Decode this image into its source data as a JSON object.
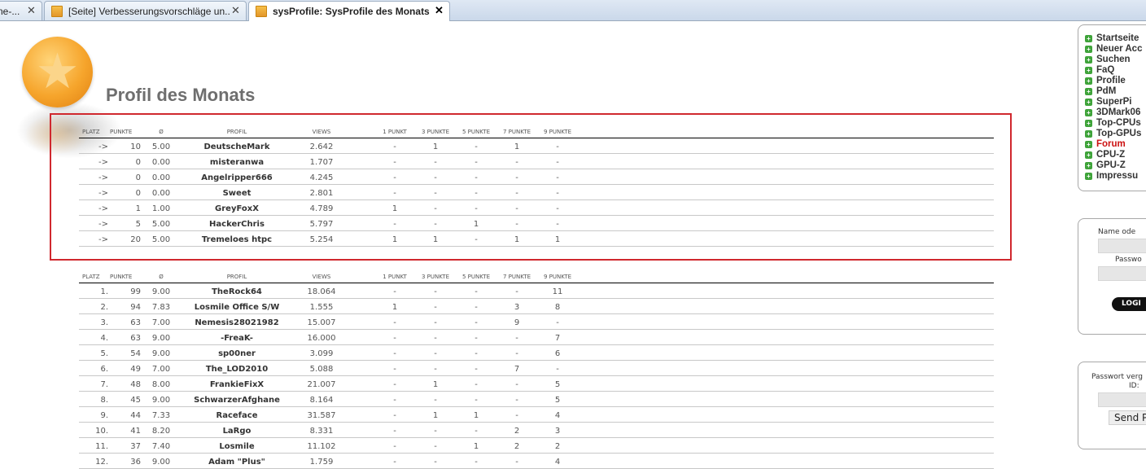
{
  "browser": {
    "tabs": [
      {
        "label": "ne-...",
        "active": false
      },
      {
        "label": "[Seite] Verbesserungsvorschläge un...",
        "active": false
      },
      {
        "label": "sysProfile: SysProfile des Monats",
        "active": true
      }
    ],
    "close_glyph": "✕"
  },
  "page": {
    "title": "Profil des Monats"
  },
  "table_headers": {
    "platz": "PLATZ",
    "punkte": "PUNKTE",
    "avg": "Ø",
    "profil": "PROFIL",
    "views": "VIEWS",
    "p1": "1 PUNKT",
    "p3": "3 PUNKTE",
    "p5": "5 PUNKTE",
    "p7": "7 PUNKTE",
    "p9": "9 PUNKTE"
  },
  "upcoming": {
    "rows": [
      {
        "platz": "->",
        "punkte": "10",
        "avg": "5.00",
        "profil": "DeutscheMark",
        "views": "2.642",
        "p1": "-",
        "p3": "1",
        "p5": "-",
        "p7": "1",
        "p9": "-"
      },
      {
        "platz": "->",
        "punkte": "0",
        "avg": "0.00",
        "profil": "misteranwa",
        "views": "1.707",
        "p1": "-",
        "p3": "-",
        "p5": "-",
        "p7": "-",
        "p9": "-"
      },
      {
        "platz": "->",
        "punkte": "0",
        "avg": "0.00",
        "profil": "Angelripper666",
        "views": "4.245",
        "p1": "-",
        "p3": "-",
        "p5": "-",
        "p7": "-",
        "p9": "-"
      },
      {
        "platz": "->",
        "punkte": "0",
        "avg": "0.00",
        "profil": "Sweet",
        "views": "2.801",
        "p1": "-",
        "p3": "-",
        "p5": "-",
        "p7": "-",
        "p9": "-"
      },
      {
        "platz": "->",
        "punkte": "1",
        "avg": "1.00",
        "profil": "GreyFoxX",
        "views": "4.789",
        "p1": "1",
        "p3": "-",
        "p5": "-",
        "p7": "-",
        "p9": "-"
      },
      {
        "platz": "->",
        "punkte": "5",
        "avg": "5.00",
        "profil": "HackerChris",
        "views": "5.797",
        "p1": "-",
        "p3": "-",
        "p5": "1",
        "p7": "-",
        "p9": "-"
      },
      {
        "platz": "->",
        "punkte": "20",
        "avg": "5.00",
        "profil": "Tremeloes htpc",
        "views": "5.254",
        "p1": "1",
        "p3": "1",
        "p5": "-",
        "p7": "1",
        "p9": "1"
      }
    ]
  },
  "ranking": {
    "rows": [
      {
        "platz": "1.",
        "punkte": "99",
        "avg": "9.00",
        "profil": "TheRock64",
        "views": "18.064",
        "p1": "-",
        "p3": "-",
        "p5": "-",
        "p7": "-",
        "p9": "11"
      },
      {
        "platz": "2.",
        "punkte": "94",
        "avg": "7.83",
        "profil": "Losmile Office S/W",
        "views": "1.555",
        "p1": "1",
        "p3": "-",
        "p5": "-",
        "p7": "3",
        "p9": "8"
      },
      {
        "platz": "3.",
        "punkte": "63",
        "avg": "7.00",
        "profil": "Nemesis28021982",
        "views": "15.007",
        "p1": "-",
        "p3": "-",
        "p5": "-",
        "p7": "9",
        "p9": "-"
      },
      {
        "platz": "4.",
        "punkte": "63",
        "avg": "9.00",
        "profil": "-FreaK-",
        "views": "16.000",
        "p1": "-",
        "p3": "-",
        "p5": "-",
        "p7": "-",
        "p9": "7"
      },
      {
        "platz": "5.",
        "punkte": "54",
        "avg": "9.00",
        "profil": "sp00ner",
        "views": "3.099",
        "p1": "-",
        "p3": "-",
        "p5": "-",
        "p7": "-",
        "p9": "6"
      },
      {
        "platz": "6.",
        "punkte": "49",
        "avg": "7.00",
        "profil": "The_LOD2010",
        "views": "5.088",
        "p1": "-",
        "p3": "-",
        "p5": "-",
        "p7": "7",
        "p9": "-"
      },
      {
        "platz": "7.",
        "punkte": "48",
        "avg": "8.00",
        "profil": "FrankieFixX",
        "views": "21.007",
        "p1": "-",
        "p3": "1",
        "p5": "-",
        "p7": "-",
        "p9": "5"
      },
      {
        "platz": "8.",
        "punkte": "45",
        "avg": "9.00",
        "profil": "SchwarzerAfghane",
        "views": "8.164",
        "p1": "-",
        "p3": "-",
        "p5": "-",
        "p7": "-",
        "p9": "5"
      },
      {
        "platz": "9.",
        "punkte": "44",
        "avg": "7.33",
        "profil": "Raceface",
        "views": "31.587",
        "p1": "-",
        "p3": "1",
        "p5": "1",
        "p7": "-",
        "p9": "4"
      },
      {
        "platz": "10.",
        "punkte": "41",
        "avg": "8.20",
        "profil": "LaRgo",
        "views": "8.331",
        "p1": "-",
        "p3": "-",
        "p5": "-",
        "p7": "2",
        "p9": "3"
      },
      {
        "platz": "11.",
        "punkte": "37",
        "avg": "7.40",
        "profil": "Losmile",
        "views": "11.102",
        "p1": "-",
        "p3": "-",
        "p5": "1",
        "p7": "2",
        "p9": "2"
      },
      {
        "platz": "12.",
        "punkte": "36",
        "avg": "9.00",
        "profil": "Adam \"Plus\"",
        "views": "1.759",
        "p1": "-",
        "p3": "-",
        "p5": "-",
        "p7": "-",
        "p9": "4"
      }
    ]
  },
  "sidebar": {
    "nav": [
      {
        "label": "Startseite",
        "highlight": false
      },
      {
        "label": "Neuer Acc",
        "highlight": false
      },
      {
        "label": "Suchen",
        "highlight": false
      },
      {
        "label": "FaQ",
        "highlight": false
      },
      {
        "label": "Profile",
        "highlight": false
      },
      {
        "label": "PdM",
        "highlight": false
      },
      {
        "label": "SuperPi",
        "highlight": false
      },
      {
        "label": "3DMark06",
        "highlight": false
      },
      {
        "label": "Top-CPUs",
        "highlight": false
      },
      {
        "label": "Top-GPUs",
        "highlight": false
      },
      {
        "label": "Forum",
        "highlight": true
      },
      {
        "label": "CPU-Z",
        "highlight": false
      },
      {
        "label": "GPU-Z",
        "highlight": false
      },
      {
        "label": "Impressu",
        "highlight": false
      }
    ],
    "login": {
      "name_label": "Name ode",
      "password_label": "Passwo",
      "button_label": "LOGI"
    },
    "forgot": {
      "label_line1": "Passwort verg",
      "label_line2": "ID:",
      "button_label": "Send P"
    }
  },
  "colors": {
    "highlight_box": "#d0282e",
    "nav_bullet": "#3fa33a",
    "nav_hot": "#cc1111"
  }
}
